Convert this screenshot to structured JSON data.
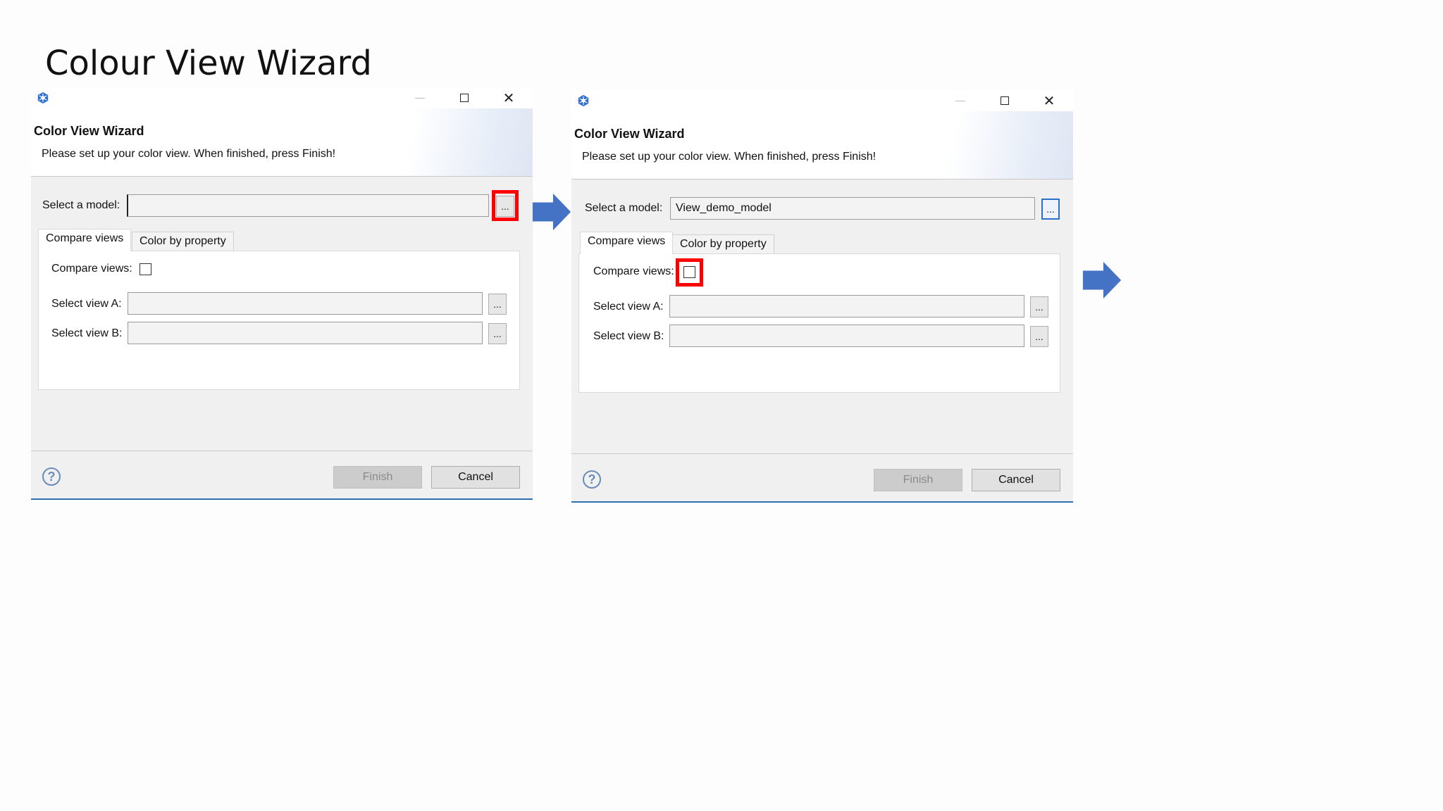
{
  "slide": {
    "title": "Colour View Wizard"
  },
  "colors": {
    "arrow": "#4472c4",
    "highlight": "#ff0000",
    "accent": "#2e6fb0"
  },
  "dialogs": [
    {
      "header_title": "Color View Wizard",
      "header_desc": "Please set up your color view. When finished, press Finish!",
      "model_label": "Select a model:",
      "model_value": "",
      "browse_label": "...",
      "tabs": [
        "Compare views",
        "Color by property"
      ],
      "compare_label": "Compare views:",
      "view_a_label": "Select view A:",
      "view_b_label": "Select view B:",
      "finish_label": "Finish",
      "cancel_label": "Cancel",
      "highlighted": "model-browse-button"
    },
    {
      "header_title": "Color View Wizard",
      "header_desc": "Please set up your color view. When finished, press Finish!",
      "model_label": "Select a model:",
      "model_value": "View_demo_model",
      "browse_label": "...",
      "tabs": [
        "Compare views",
        "Color by property"
      ],
      "compare_label": "Compare views:",
      "view_a_label": "Select view A:",
      "view_b_label": "Select view B:",
      "finish_label": "Finish",
      "cancel_label": "Cancel",
      "highlighted": "compare-views-checkbox"
    }
  ],
  "icons": {
    "app": "wizard-app-icon",
    "minimize": "minimize-icon",
    "maximize": "maximize-icon",
    "close": "close-icon",
    "help": "help-icon",
    "flow": "right-arrow-icon"
  },
  "glyphs": {
    "close": "✕",
    "help": "?"
  }
}
